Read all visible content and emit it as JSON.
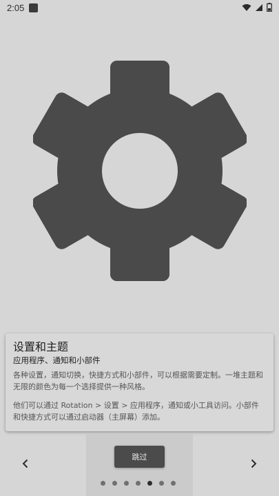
{
  "status_bar": {
    "time": "2:05",
    "icons": [
      "notification-icon",
      "wifi-icon",
      "signal-icon",
      "battery-icon"
    ]
  },
  "hero": {
    "icon": "gear-icon",
    "icon_color": "#4a4a4a",
    "icon_hole_color": "#d6d6d6"
  },
  "card": {
    "title": "设置和主题",
    "subtitle": "应用程序、通知和小部件",
    "paragraph1": "各种设置，通知切换，快捷方式和小部件，可以根据需要定制。一堆主题和无限的颜色为每一个选择提供一种风格。",
    "paragraph2": "他们可以通过 Rotation > 设置 > 应用程序，通知或小工具访问。小部件和快捷方式可以通过启动器（主屏幕）添加。"
  },
  "navigation": {
    "prev_icon": "chevron-left-icon",
    "next_icon": "chevron-right-icon",
    "skip_label": "跳过",
    "page_count": 7,
    "current_page": 5
  },
  "colors": {
    "background": "#d6d6d6",
    "button": "#4b4b4b",
    "dot_active": "#2e2e2e",
    "dot_inactive": "#707070"
  }
}
